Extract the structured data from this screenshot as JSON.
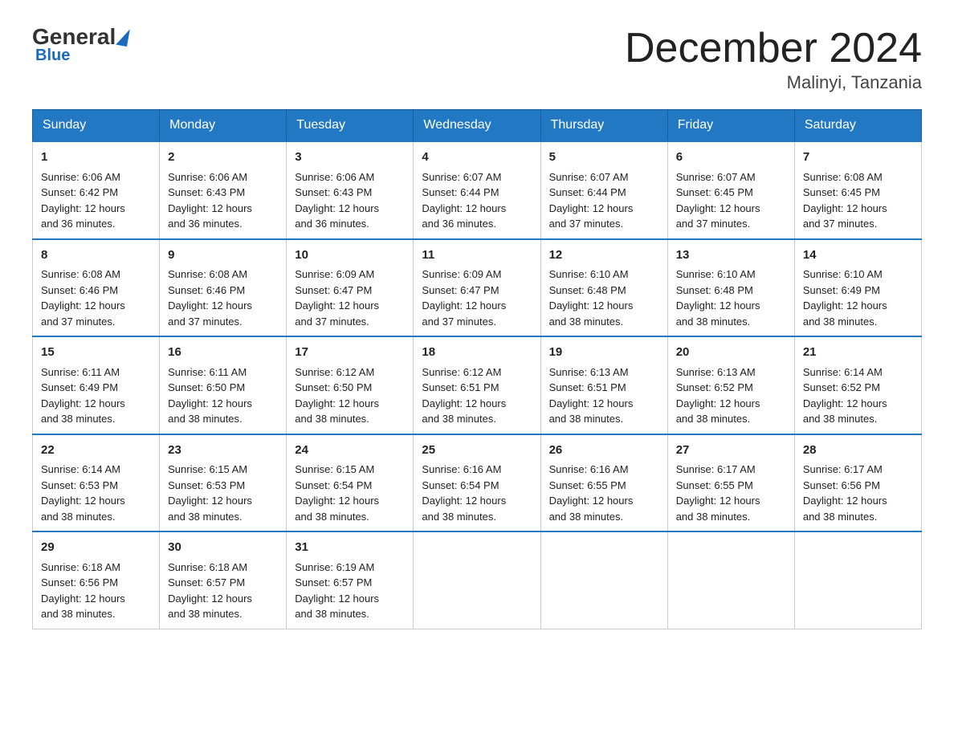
{
  "logo": {
    "general": "General",
    "blue": "Blue"
  },
  "title": "December 2024",
  "subtitle": "Malinyi, Tanzania",
  "days": [
    "Sunday",
    "Monday",
    "Tuesday",
    "Wednesday",
    "Thursday",
    "Friday",
    "Saturday"
  ],
  "weeks": [
    [
      {
        "num": "1",
        "sunrise": "6:06 AM",
        "sunset": "6:42 PM",
        "daylight": "12 hours and 36 minutes."
      },
      {
        "num": "2",
        "sunrise": "6:06 AM",
        "sunset": "6:43 PM",
        "daylight": "12 hours and 36 minutes."
      },
      {
        "num": "3",
        "sunrise": "6:06 AM",
        "sunset": "6:43 PM",
        "daylight": "12 hours and 36 minutes."
      },
      {
        "num": "4",
        "sunrise": "6:07 AM",
        "sunset": "6:44 PM",
        "daylight": "12 hours and 36 minutes."
      },
      {
        "num": "5",
        "sunrise": "6:07 AM",
        "sunset": "6:44 PM",
        "daylight": "12 hours and 37 minutes."
      },
      {
        "num": "6",
        "sunrise": "6:07 AM",
        "sunset": "6:45 PM",
        "daylight": "12 hours and 37 minutes."
      },
      {
        "num": "7",
        "sunrise": "6:08 AM",
        "sunset": "6:45 PM",
        "daylight": "12 hours and 37 minutes."
      }
    ],
    [
      {
        "num": "8",
        "sunrise": "6:08 AM",
        "sunset": "6:46 PM",
        "daylight": "12 hours and 37 minutes."
      },
      {
        "num": "9",
        "sunrise": "6:08 AM",
        "sunset": "6:46 PM",
        "daylight": "12 hours and 37 minutes."
      },
      {
        "num": "10",
        "sunrise": "6:09 AM",
        "sunset": "6:47 PM",
        "daylight": "12 hours and 37 minutes."
      },
      {
        "num": "11",
        "sunrise": "6:09 AM",
        "sunset": "6:47 PM",
        "daylight": "12 hours and 37 minutes."
      },
      {
        "num": "12",
        "sunrise": "6:10 AM",
        "sunset": "6:48 PM",
        "daylight": "12 hours and 38 minutes."
      },
      {
        "num": "13",
        "sunrise": "6:10 AM",
        "sunset": "6:48 PM",
        "daylight": "12 hours and 38 minutes."
      },
      {
        "num": "14",
        "sunrise": "6:10 AM",
        "sunset": "6:49 PM",
        "daylight": "12 hours and 38 minutes."
      }
    ],
    [
      {
        "num": "15",
        "sunrise": "6:11 AM",
        "sunset": "6:49 PM",
        "daylight": "12 hours and 38 minutes."
      },
      {
        "num": "16",
        "sunrise": "6:11 AM",
        "sunset": "6:50 PM",
        "daylight": "12 hours and 38 minutes."
      },
      {
        "num": "17",
        "sunrise": "6:12 AM",
        "sunset": "6:50 PM",
        "daylight": "12 hours and 38 minutes."
      },
      {
        "num": "18",
        "sunrise": "6:12 AM",
        "sunset": "6:51 PM",
        "daylight": "12 hours and 38 minutes."
      },
      {
        "num": "19",
        "sunrise": "6:13 AM",
        "sunset": "6:51 PM",
        "daylight": "12 hours and 38 minutes."
      },
      {
        "num": "20",
        "sunrise": "6:13 AM",
        "sunset": "6:52 PM",
        "daylight": "12 hours and 38 minutes."
      },
      {
        "num": "21",
        "sunrise": "6:14 AM",
        "sunset": "6:52 PM",
        "daylight": "12 hours and 38 minutes."
      }
    ],
    [
      {
        "num": "22",
        "sunrise": "6:14 AM",
        "sunset": "6:53 PM",
        "daylight": "12 hours and 38 minutes."
      },
      {
        "num": "23",
        "sunrise": "6:15 AM",
        "sunset": "6:53 PM",
        "daylight": "12 hours and 38 minutes."
      },
      {
        "num": "24",
        "sunrise": "6:15 AM",
        "sunset": "6:54 PM",
        "daylight": "12 hours and 38 minutes."
      },
      {
        "num": "25",
        "sunrise": "6:16 AM",
        "sunset": "6:54 PM",
        "daylight": "12 hours and 38 minutes."
      },
      {
        "num": "26",
        "sunrise": "6:16 AM",
        "sunset": "6:55 PM",
        "daylight": "12 hours and 38 minutes."
      },
      {
        "num": "27",
        "sunrise": "6:17 AM",
        "sunset": "6:55 PM",
        "daylight": "12 hours and 38 minutes."
      },
      {
        "num": "28",
        "sunrise": "6:17 AM",
        "sunset": "6:56 PM",
        "daylight": "12 hours and 38 minutes."
      }
    ],
    [
      {
        "num": "29",
        "sunrise": "6:18 AM",
        "sunset": "6:56 PM",
        "daylight": "12 hours and 38 minutes."
      },
      {
        "num": "30",
        "sunrise": "6:18 AM",
        "sunset": "6:57 PM",
        "daylight": "12 hours and 38 minutes."
      },
      {
        "num": "31",
        "sunrise": "6:19 AM",
        "sunset": "6:57 PM",
        "daylight": "12 hours and 38 minutes."
      },
      null,
      null,
      null,
      null
    ]
  ],
  "labels": {
    "sunrise": "Sunrise:",
    "sunset": "Sunset:",
    "daylight": "Daylight:"
  }
}
